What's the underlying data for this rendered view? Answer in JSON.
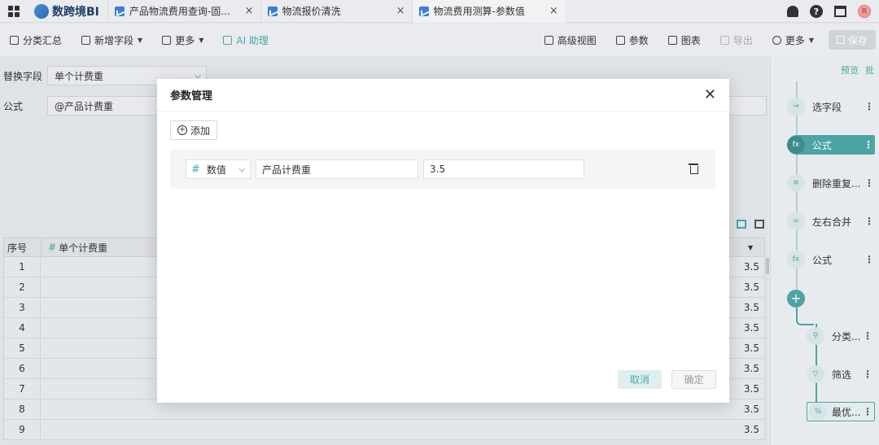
{
  "brand": {
    "name": "数跨境BI"
  },
  "tabs": [
    {
      "label": "产品物流费用查询-固...",
      "close": "×"
    },
    {
      "label": "物流报价清洗",
      "close": "×"
    },
    {
      "label": "物流费用测算-参数值",
      "close": "×"
    }
  ],
  "top_right": {
    "help": "?",
    "avatar": "R"
  },
  "toolbar": {
    "group_summary": "分类汇总",
    "add_field": "新增字段",
    "more": "更多",
    "ai_assistant": "AI 助理",
    "advanced_view": "高级视图",
    "params": "参数",
    "chart": "图表",
    "export": "导出",
    "more_right": "更多",
    "save": "保存"
  },
  "editor": {
    "replace_label": "替换字段",
    "replace_value": "单个计费重",
    "formula_label": "公式",
    "formula_value": "@产品计费重"
  },
  "grid": {
    "index_header": "序号",
    "hash": "#",
    "column_header": "单个计费重",
    "rows": [
      {
        "idx": "1",
        "value": "3.5"
      },
      {
        "idx": "2",
        "value": "3.5"
      },
      {
        "idx": "3",
        "value": "3.5"
      },
      {
        "idx": "4",
        "value": "3.5"
      },
      {
        "idx": "5",
        "value": "3.5"
      },
      {
        "idx": "6",
        "value": "3.5"
      },
      {
        "idx": "7",
        "value": "3.5"
      },
      {
        "idx": "8",
        "value": "3.5"
      },
      {
        "idx": "9",
        "value": "3.5"
      }
    ]
  },
  "flow": {
    "preview": "预览",
    "batch": "批",
    "nodes": [
      {
        "label": "选字段",
        "icon": "select-icon"
      },
      {
        "label": "公式",
        "icon": "fx-icon"
      },
      {
        "label": "删除重复...",
        "icon": "dedupe-icon"
      },
      {
        "label": "左右合并",
        "icon": "merge-icon"
      },
      {
        "label": "公式",
        "icon": "fx-icon"
      },
      {
        "label": "分类...",
        "icon": "group-icon"
      },
      {
        "label": "筛选",
        "icon": "filter-icon"
      },
      {
        "label": "最优...",
        "icon": "optimize-icon"
      }
    ],
    "more": "⋮",
    "add": "+"
  },
  "dialog": {
    "title": "参数管理",
    "add_label": "添加",
    "param": {
      "type": "数值",
      "name": "产品计费重",
      "value": "3.5"
    },
    "cancel": "取消",
    "confirm": "确定"
  },
  "colors": {
    "accent": "#4ea8a8",
    "background": "#e8ebef"
  }
}
